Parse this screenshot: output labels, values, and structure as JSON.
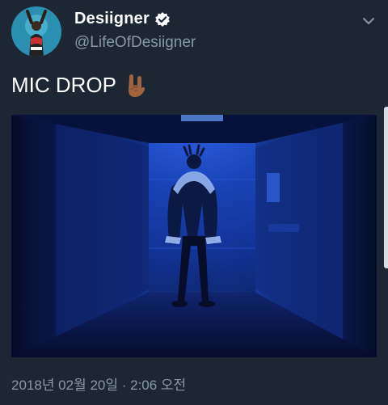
{
  "user": {
    "display_name": "Desiigner",
    "handle": "@LifeOfDesiigner",
    "verified": true
  },
  "tweet": {
    "text": "MIC DROP",
    "emoji": "sign-of-the-horns-emoji",
    "timestamp": "2018년 02월 20일 · 2:06 오전"
  },
  "icons": {
    "verified": "verified-badge-icon",
    "menu": "chevron-down-icon"
  },
  "colors": {
    "background": "#1c2733",
    "secondary_text": "#8899a6",
    "verified_blue": "#1da1f2"
  }
}
